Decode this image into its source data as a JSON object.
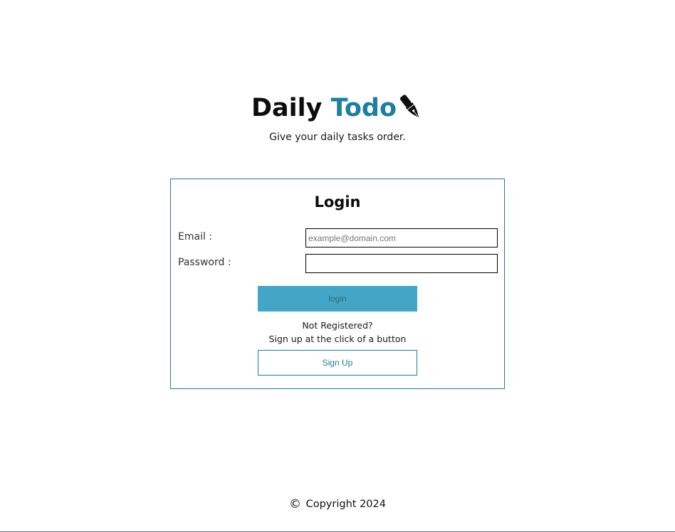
{
  "brand": {
    "title_part1": "Daily ",
    "title_part2": "Todo",
    "logo_icon": "fountain-pen-icon",
    "tagline": "Give your daily tasks order."
  },
  "login": {
    "heading": "Login",
    "email_label": "Email :",
    "email_placeholder": "example@domain.com",
    "email_value": "",
    "password_label": "Password :",
    "password_value": "",
    "login_button": "login",
    "register_line1": "Not Registered?",
    "register_line2": "Sign up at the click of a button",
    "signup_button": "Sign Up"
  },
  "footer": {
    "copyright_icon": "copyright-icon",
    "copyright_text": "Copyright 2024"
  },
  "colors": {
    "accent": "#1a7fa1",
    "login_button_bg": "#44a6c6",
    "card_border": "#1b7f9a"
  }
}
